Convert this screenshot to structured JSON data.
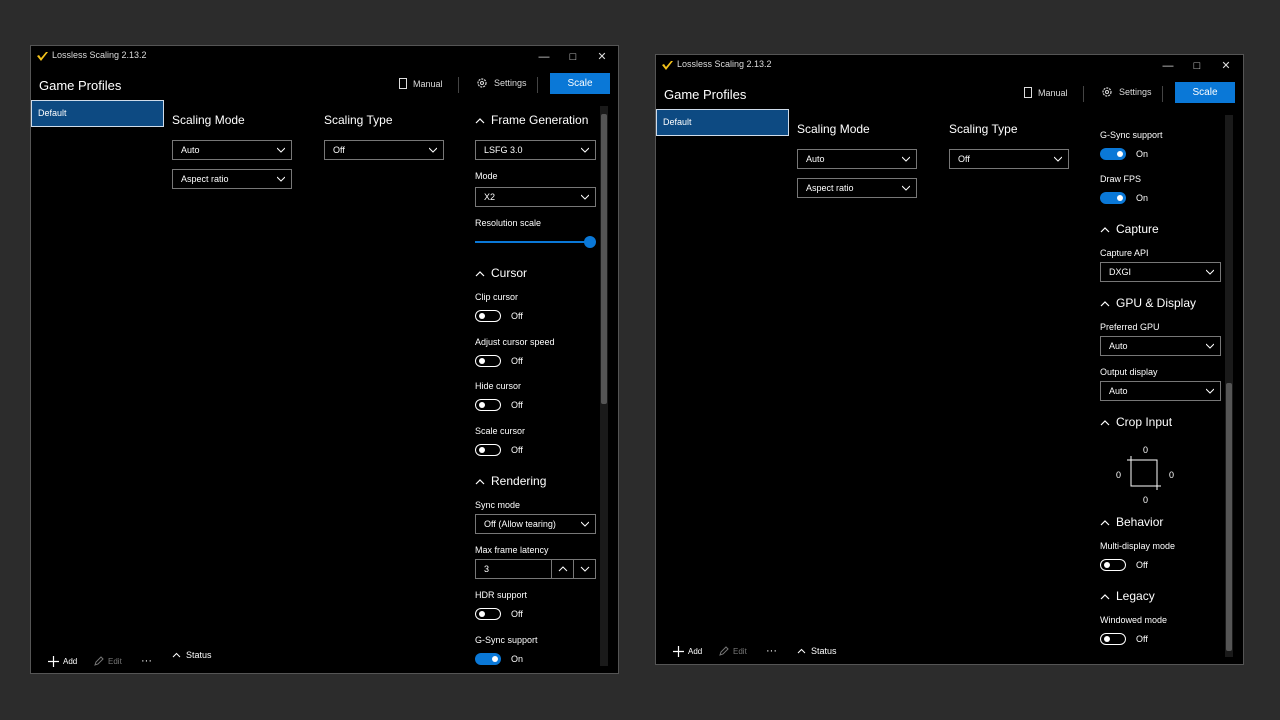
{
  "app": {
    "title": "Lossless Scaling 2.13.2",
    "minimize_glyph": "—",
    "maximize_glyph": "□",
    "close_glyph": "✕"
  },
  "header": {
    "game_profiles": "Game Profiles",
    "manual": "Manual",
    "settings": "Settings",
    "scale": "Scale"
  },
  "sidebar": {
    "profiles": [
      "Default"
    ]
  },
  "footer": {
    "add": "Add",
    "edit": "Edit",
    "more": "···",
    "status": "Status"
  },
  "scaling": {
    "mode_title": "Scaling Mode",
    "mode_value": "Auto",
    "aspect_value": "Aspect ratio",
    "type_title": "Scaling Type",
    "type_value": "Off"
  },
  "frame_generation": {
    "title": "Frame Generation",
    "value": "LSFG 3.0",
    "mode_label": "Mode",
    "mode_value": "X2",
    "resolution_scale_label": "Resolution scale",
    "resolution_scale": 1.0
  },
  "cursor": {
    "title": "Cursor",
    "clip_label": "Clip cursor",
    "clip_state": "Off",
    "adjust_label": "Adjust cursor speed",
    "adjust_state": "Off",
    "hide_label": "Hide cursor",
    "hide_state": "Off",
    "scale_label": "Scale cursor",
    "scale_state": "Off"
  },
  "rendering": {
    "title": "Rendering",
    "sync_label": "Sync mode",
    "sync_value": "Off (Allow tearing)",
    "latency_label": "Max frame latency",
    "latency_value": "3",
    "hdr_label": "HDR support",
    "hdr_state": "Off",
    "gsync_label": "G-Sync support",
    "gsync_state": "On",
    "drawfps_label": "Draw FPS",
    "drawfps_state": "On"
  },
  "capture": {
    "title": "Capture",
    "api_label": "Capture API",
    "api_value": "DXGI"
  },
  "gpu_display": {
    "title": "GPU & Display",
    "gpu_label": "Preferred GPU",
    "gpu_value": "Auto",
    "output_label": "Output display",
    "output_value": "Auto"
  },
  "crop_input": {
    "title": "Crop Input",
    "top": "0",
    "left": "0",
    "right": "0",
    "bottom": "0"
  },
  "behavior": {
    "title": "Behavior",
    "multi_label": "Multi-display mode",
    "multi_state": "Off"
  },
  "legacy": {
    "title": "Legacy",
    "windowed_label": "Windowed mode",
    "windowed_state": "Off"
  },
  "colors": {
    "accent": "#0a78d7",
    "selection": "#0d4a82",
    "background": "#000000",
    "desktop": "#2c2c2c"
  }
}
